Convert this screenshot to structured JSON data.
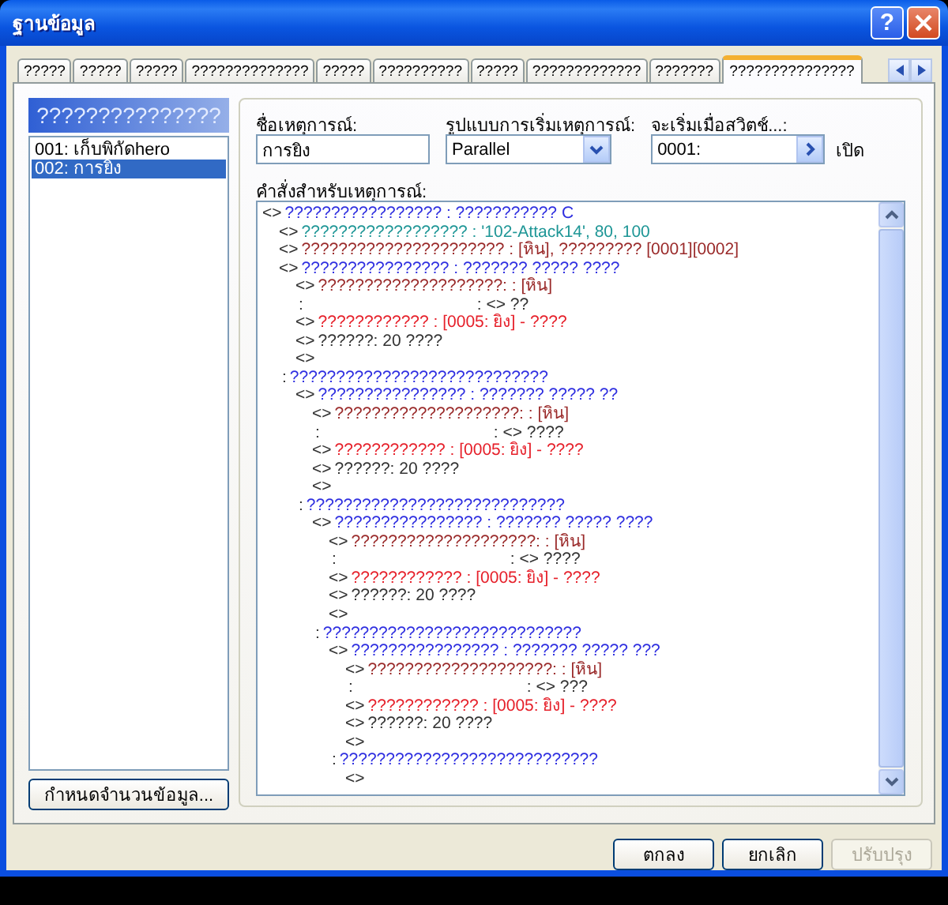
{
  "window": {
    "title": "ฐานข้อมูล",
    "help": "?"
  },
  "tabs": [
    {
      "label": "?????",
      "selected": false
    },
    {
      "label": "?????",
      "selected": false
    },
    {
      "label": "?????",
      "selected": false
    },
    {
      "label": "??????????????",
      "selected": false
    },
    {
      "label": "?????",
      "selected": false
    },
    {
      "label": "??????????",
      "selected": false
    },
    {
      "label": "?????",
      "selected": false
    },
    {
      "label": "?????????????",
      "selected": false
    },
    {
      "label": "???????",
      "selected": false
    },
    {
      "label": "???????????????",
      "selected": true
    }
  ],
  "event_list": {
    "header": "???????????????",
    "items": [
      {
        "label": "001: เก็บพิกัดhero",
        "selected": false
      },
      {
        "label": "002: การยิง",
        "selected": true
      }
    ],
    "button": "กำหนดจำนวนข้อมูล..."
  },
  "event": {
    "name_label": "ชื่อเหตุการณ์:",
    "name": "การยิง",
    "trigger_label": "รูปแบบการเริ่มเหตุการณ์:",
    "trigger": "Parallel",
    "switch_label": "จะเริ่มเมื่อสวิตช์...:",
    "switch": "0001:",
    "switch_state": "เปิด",
    "commands_label": "คำสั่งสำหรับเหตุการณ์:",
    "commands": [
      {
        "kind": "command",
        "marker": "<>",
        "text": "????????????????? : ??????????? C",
        "color": "#2e2ee0",
        "children": [
          {
            "kind": "command",
            "marker": "<>",
            "text": "?????????????????? : '102-Attack14', 80, 100",
            "color": "#1e9696"
          },
          {
            "kind": "command",
            "marker": "<>",
            "text": "?????????????????????? : [หิน], ????????? [0001][0002]",
            "color": "#9a2a2a"
          },
          {
            "kind": "command",
            "marker": "<>",
            "text": "???????????????? : ??????? ????? ????",
            "color": "#2e2ee0",
            "children": [
              {
                "kind": "command",
                "marker": "<>",
                "text": "????????????????????: : [หิน]",
                "color": "#9a2a2a"
              },
              {
                "kind": "continuation",
                "marker": ":",
                "text": ": <> ??",
                "color": "#333333"
              },
              {
                "kind": "command",
                "marker": "<>",
                "text": "???????????? : [0005: ยิง] - ????",
                "color": "#e6202a"
              },
              {
                "kind": "command",
                "marker": "<>",
                "text": "??????: 20 ????",
                "color": "#333333"
              },
              {
                "kind": "command",
                "marker": "<>"
              }
            ]
          },
          {
            "kind": "command",
            "marker": ":",
            "text": "????????????????????????????",
            "color": "#2e2ee0",
            "children": [
              {
                "kind": "command",
                "marker": "<>",
                "text": "???????????????? : ??????? ????? ??",
                "color": "#2e2ee0",
                "children": [
                  {
                    "kind": "command",
                    "marker": "<>",
                    "text": "????????????????????: : [หิน]",
                    "color": "#9a2a2a"
                  },
                  {
                    "kind": "continuation",
                    "marker": ":",
                    "text": ": <> ????",
                    "color": "#333333"
                  },
                  {
                    "kind": "command",
                    "marker": "<>",
                    "text": "???????????? : [0005: ยิง] - ????",
                    "color": "#e6202a"
                  },
                  {
                    "kind": "command",
                    "marker": "<>",
                    "text": "??????: 20 ????",
                    "color": "#333333"
                  },
                  {
                    "kind": "command",
                    "marker": "<>"
                  }
                ]
              },
              {
                "kind": "command",
                "marker": ":",
                "text": "????????????????????????????",
                "color": "#2e2ee0",
                "children": [
                  {
                    "kind": "command",
                    "marker": "<>",
                    "text": "???????????????? : ??????? ????? ????",
                    "color": "#2e2ee0",
                    "children": [
                      {
                        "kind": "command",
                        "marker": "<>",
                        "text": "????????????????????: : [หิน]",
                        "color": "#9a2a2a"
                      },
                      {
                        "kind": "continuation",
                        "marker": ":",
                        "text": ": <> ????",
                        "color": "#333333"
                      },
                      {
                        "kind": "command",
                        "marker": "<>",
                        "text": "???????????? : [0005: ยิง] - ????",
                        "color": "#e6202a"
                      },
                      {
                        "kind": "command",
                        "marker": "<>",
                        "text": "??????: 20 ????",
                        "color": "#333333"
                      },
                      {
                        "kind": "command",
                        "marker": "<>"
                      }
                    ]
                  },
                  {
                    "kind": "command",
                    "marker": ":",
                    "text": "????????????????????????????",
                    "color": "#2e2ee0",
                    "children": [
                      {
                        "kind": "command",
                        "marker": "<>",
                        "text": "???????????????? : ??????? ????? ???",
                        "color": "#2e2ee0",
                        "children": [
                          {
                            "kind": "command",
                            "marker": "<>",
                            "text": "????????????????????: : [หิน]",
                            "color": "#9a2a2a"
                          },
                          {
                            "kind": "continuation",
                            "marker": ":",
                            "text": ": <> ???",
                            "color": "#333333"
                          },
                          {
                            "kind": "command",
                            "marker": "<>",
                            "text": "???????????? : [0005: ยิง] - ????",
                            "color": "#e6202a"
                          },
                          {
                            "kind": "command",
                            "marker": "<>",
                            "text": "??????: 20 ????",
                            "color": "#333333"
                          },
                          {
                            "kind": "command",
                            "marker": "<>"
                          }
                        ]
                      },
                      {
                        "kind": "command",
                        "marker": ":",
                        "text": "????????????????????????????",
                        "color": "#2e2ee0",
                        "children": [
                          {
                            "kind": "command",
                            "marker": "<>"
                          }
                        ]
                      }
                    ]
                  }
                ]
              }
            ]
          }
        ]
      }
    ]
  },
  "buttons": [
    {
      "label": "ตกลง",
      "disabled": false
    },
    {
      "label": "ยกเลิก",
      "disabled": false
    },
    {
      "label": "ปรับปรุง",
      "disabled": true
    }
  ]
}
